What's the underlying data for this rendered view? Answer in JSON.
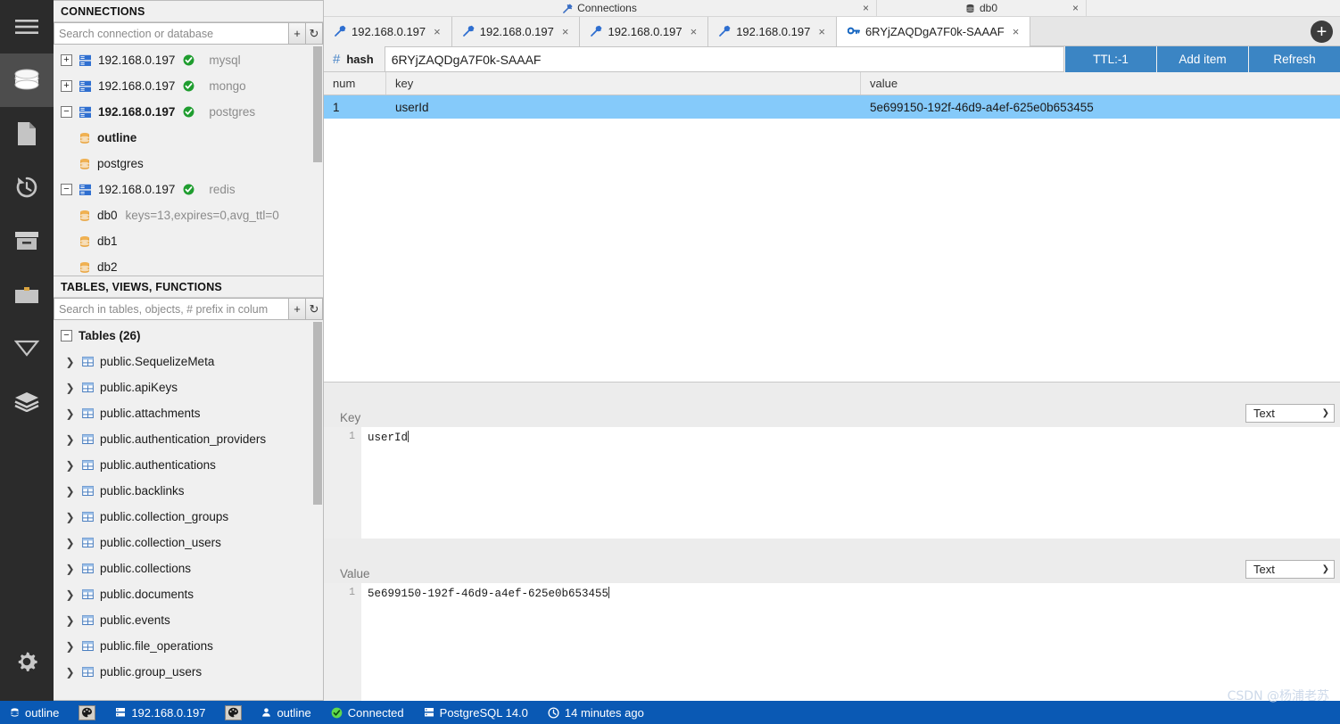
{
  "rail": {
    "items": [
      {
        "name": "menu-icon",
        "label": "Menu"
      },
      {
        "name": "database-icon",
        "label": "Database Navigator"
      },
      {
        "name": "file-icon",
        "label": "Projects"
      },
      {
        "name": "history-icon",
        "label": "Query History"
      },
      {
        "name": "archive-icon",
        "label": "Archive"
      },
      {
        "name": "briefcase-icon",
        "label": "Briefcase"
      },
      {
        "name": "filter-icon",
        "label": "Filter"
      },
      {
        "name": "layers-icon",
        "label": "Layers"
      }
    ],
    "settings_label": "Settings"
  },
  "connections_panel": {
    "title": "CONNECTIONS",
    "search_placeholder": "Search connection or database",
    "add_label": "+",
    "refresh_label": "↻",
    "tree": [
      {
        "toggle": "+",
        "label": "192.168.0.197",
        "status": "ok",
        "sub": "mysql",
        "bold": false,
        "level": 0,
        "icon": "server-icon"
      },
      {
        "toggle": "+",
        "label": "192.168.0.197",
        "status": "ok",
        "sub": "mongo",
        "bold": false,
        "level": 0,
        "icon": "server-icon"
      },
      {
        "toggle": "−",
        "label": "192.168.0.197",
        "status": "ok",
        "sub": "postgres",
        "bold": true,
        "level": 0,
        "icon": "server-icon"
      },
      {
        "toggle": "",
        "label": "outline",
        "status": "",
        "sub": "",
        "bold": true,
        "level": 1,
        "icon": "db-icon"
      },
      {
        "toggle": "",
        "label": "postgres",
        "status": "",
        "sub": "",
        "bold": false,
        "level": 1,
        "icon": "db-icon"
      },
      {
        "toggle": "−",
        "label": "192.168.0.197",
        "status": "ok",
        "sub": "redis",
        "bold": false,
        "level": 0,
        "icon": "server-icon"
      },
      {
        "toggle": "",
        "label": "db0",
        "status": "",
        "sub": "keys=13,expires=0,avg_ttl=0",
        "bold": false,
        "level": 1,
        "icon": "db-icon"
      },
      {
        "toggle": "",
        "label": "db1",
        "status": "",
        "sub": "",
        "bold": false,
        "level": 1,
        "icon": "db-icon"
      },
      {
        "toggle": "",
        "label": "db2",
        "status": "",
        "sub": "",
        "bold": false,
        "level": 1,
        "icon": "db-icon"
      }
    ]
  },
  "tables_panel": {
    "title": "TABLES, VIEWS, FUNCTIONS",
    "search_placeholder": "Search in tables, objects, # prefix in colum",
    "add_label": "+",
    "refresh_label": "↻",
    "group_toggle": "−",
    "group_label": "Tables (26)",
    "tables": [
      "public.SequelizeMeta",
      "public.apiKeys",
      "public.attachments",
      "public.authentication_providers",
      "public.authentications",
      "public.backlinks",
      "public.collection_groups",
      "public.collection_users",
      "public.collections",
      "public.documents",
      "public.events",
      "public.file_operations",
      "public.group_users"
    ]
  },
  "tab_groups": [
    {
      "label": "Connections",
      "icon": "plug-icon",
      "close": "×"
    },
    {
      "label": "db0",
      "icon": "db-icon",
      "close": "×"
    }
  ],
  "tabs": [
    {
      "label": "192.168.0.197",
      "icon": "plug-icon",
      "active": false,
      "close": "×"
    },
    {
      "label": "192.168.0.197",
      "icon": "plug-icon",
      "active": false,
      "close": "×"
    },
    {
      "label": "192.168.0.197",
      "icon": "plug-icon",
      "active": false,
      "close": "×"
    },
    {
      "label": "192.168.0.197",
      "icon": "plug-icon",
      "active": false,
      "close": "×"
    },
    {
      "label": "6RYjZAQDgA7F0k-SAAAF",
      "icon": "key-icon",
      "active": true,
      "close": "×"
    }
  ],
  "new_tab_label": "+",
  "key_toolbar": {
    "type_symbol": "#",
    "type_label": "hash",
    "key_value": "6RYjZAQDgA7F0k-SAAAF",
    "ttl_label": "TTL:-1",
    "add_item_label": "Add item",
    "refresh_label": "Refresh",
    "accent_color": "#3b85c4"
  },
  "grid": {
    "columns": [
      "num",
      "key",
      "value"
    ],
    "rows": [
      {
        "num": "1",
        "key": "userId",
        "value": "5e699150-192f-46d9-a4ef-625e0b653455"
      }
    ],
    "selection_color": "#85cafa"
  },
  "key_editor": {
    "label": "Key",
    "format": "Text",
    "line_number": "1",
    "content": "userId"
  },
  "value_editor": {
    "label": "Value",
    "format": "Text",
    "line_number": "1",
    "content": "5e699150-192f-46d9-a4ef-625e0b653455"
  },
  "statusbar": {
    "database": "outline",
    "host": "192.168.0.197",
    "user": "outline",
    "connection_state": "Connected",
    "server_version": "PostgreSQL 14.0",
    "last_activity": "14 minutes ago",
    "watermark": "CSDN @杨浦老苏",
    "accent_color": "#0a59b4"
  }
}
